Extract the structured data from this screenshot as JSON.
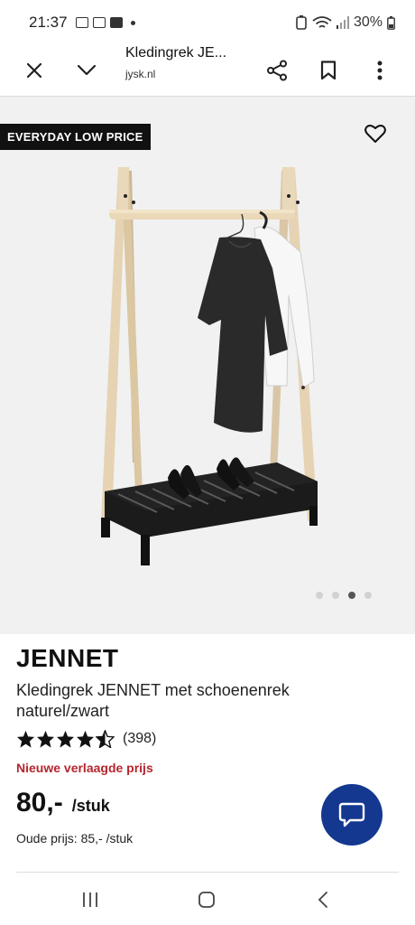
{
  "status_bar": {
    "time": "21:37",
    "battery": "30%"
  },
  "browser": {
    "page_title": "Kledingrek JE...",
    "host": "jysk.nl"
  },
  "product": {
    "badge": "EVERYDAY LOW PRICE",
    "brand": "JENNET",
    "title": "Kledingrek JENNET met schoenenrek naturel/zwart",
    "rating": 4.5,
    "rating_max": 5,
    "review_count": "(398)",
    "promo_label": "Nieuwe verlaagde prijs",
    "price": "80,-",
    "price_unit": "/stuk",
    "old_price": "Oude prijs: 85,- /stuk",
    "image_count": 4,
    "active_image_index": 3
  },
  "icons": {
    "close": "close-icon",
    "collapse": "chevron-down-icon",
    "share": "share-icon",
    "bookmark": "bookmark-icon",
    "more": "more-vertical-icon",
    "favorite": "heart-icon",
    "chat": "chat-icon"
  },
  "colors": {
    "promo_red": "#b5262f",
    "chat_blue": "#14388f",
    "badge_black": "#111111"
  }
}
